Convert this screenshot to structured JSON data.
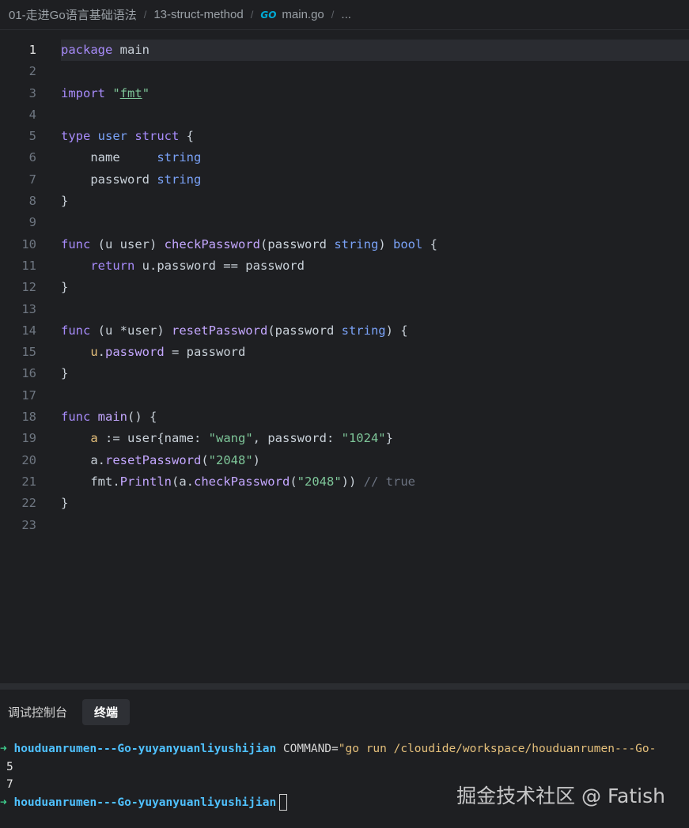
{
  "breadcrumb": {
    "items": [
      "01-走进Go语言基础语法",
      "13-struct-method",
      "main.go",
      "..."
    ],
    "file_icon": "go-file-icon"
  },
  "editor": {
    "active_line": 1,
    "lines": [
      {
        "n": "1"
      },
      {
        "n": "2"
      },
      {
        "n": "3"
      },
      {
        "n": "4"
      },
      {
        "n": "5"
      },
      {
        "n": "6"
      },
      {
        "n": "7"
      },
      {
        "n": "8"
      },
      {
        "n": "9"
      },
      {
        "n": "10"
      },
      {
        "n": "11"
      },
      {
        "n": "12"
      },
      {
        "n": "13"
      },
      {
        "n": "14"
      },
      {
        "n": "15"
      },
      {
        "n": "16"
      },
      {
        "n": "17"
      },
      {
        "n": "18"
      },
      {
        "n": "19"
      },
      {
        "n": "20"
      },
      {
        "n": "21"
      },
      {
        "n": "22"
      },
      {
        "n": "23"
      }
    ],
    "code": {
      "l1": [
        [
          "kw",
          "package"
        ],
        [
          "pl",
          " main"
        ]
      ],
      "l2": [],
      "l3": [
        [
          "kw",
          "import"
        ],
        [
          "pl",
          " "
        ],
        [
          "str",
          "\""
        ],
        [
          "strb",
          "fmt"
        ],
        [
          "str",
          "\""
        ]
      ],
      "l4": [],
      "l5": [
        [
          "kw",
          "type"
        ],
        [
          "pl",
          " "
        ],
        [
          "tp",
          "user"
        ],
        [
          "pl",
          " "
        ],
        [
          "kw",
          "struct"
        ],
        [
          "pl",
          " {"
        ]
      ],
      "l6": [
        [
          "pl",
          "    name     "
        ],
        [
          "tp",
          "string"
        ]
      ],
      "l7": [
        [
          "pl",
          "    password "
        ],
        [
          "tp",
          "string"
        ]
      ],
      "l8": [
        [
          "pl",
          "}"
        ]
      ],
      "l9": [],
      "l10": [
        [
          "kw",
          "func"
        ],
        [
          "pl",
          " (u user) "
        ],
        [
          "fnc",
          "checkPassword"
        ],
        [
          "pl",
          "(password "
        ],
        [
          "tp",
          "string"
        ],
        [
          "pl",
          ") "
        ],
        [
          "tp",
          "bool"
        ],
        [
          "pl",
          " {"
        ]
      ],
      "l11": [
        [
          "pl",
          "    "
        ],
        [
          "kw",
          "return"
        ],
        [
          "pl",
          " u.password == password"
        ]
      ],
      "l12": [
        [
          "pl",
          "}"
        ]
      ],
      "l13": [],
      "l14": [
        [
          "kw",
          "func"
        ],
        [
          "pl",
          " (u *user) "
        ],
        [
          "fnc",
          "resetPassword"
        ],
        [
          "pl",
          "(password "
        ],
        [
          "tp",
          "string"
        ],
        [
          "pl",
          ") {"
        ]
      ],
      "l15": [
        [
          "pl",
          "    "
        ],
        [
          "var",
          "u"
        ],
        [
          "pl",
          "."
        ],
        [
          "fnc",
          "password"
        ],
        [
          "pl",
          " = password"
        ]
      ],
      "l16": [
        [
          "pl",
          "}"
        ]
      ],
      "l17": [],
      "l18": [
        [
          "kw",
          "func"
        ],
        [
          "pl",
          " "
        ],
        [
          "fnc",
          "main"
        ],
        [
          "pl",
          "() {"
        ]
      ],
      "l19": [
        [
          "pl",
          "    "
        ],
        [
          "var",
          "a"
        ],
        [
          "pl",
          " := user{name: "
        ],
        [
          "str",
          "\"wang\""
        ],
        [
          "pl",
          ", password: "
        ],
        [
          "str",
          "\"1024\""
        ],
        [
          "pl",
          "}"
        ]
      ],
      "l20": [
        [
          "pl",
          "    a."
        ],
        [
          "fnc",
          "resetPassword"
        ],
        [
          "pl",
          "("
        ],
        [
          "str",
          "\"2048\""
        ],
        [
          "pl",
          ")"
        ]
      ],
      "l21": [
        [
          "pl",
          "    fmt."
        ],
        [
          "fnc",
          "Println"
        ],
        [
          "pl",
          "(a."
        ],
        [
          "fnc",
          "checkPassword"
        ],
        [
          "pl",
          "("
        ],
        [
          "str",
          "\"2048\""
        ],
        [
          "pl",
          "))"
        ],
        [
          "cmt",
          " // true"
        ]
      ],
      "l22": [
        [
          "pl",
          "}"
        ]
      ],
      "l23": []
    }
  },
  "panel": {
    "tabs": [
      {
        "label": "调试控制台",
        "active": false
      },
      {
        "label": "终端",
        "active": true
      }
    ]
  },
  "terminal": {
    "prompt_arrow": "➜",
    "host": "houduanrumen---Go-yuyanyuanliyushijian",
    "command_key": " COMMAND=",
    "command_value": "\"go run /cloudide/workspace/houduanrumen---Go-",
    "outputs": [
      "5",
      "7"
    ]
  },
  "watermark": "掘金技术社区 @ Fatish",
  "colors": {
    "background": "#1e1f22",
    "keyword": "#a78bfa",
    "type": "#7aa2f7",
    "string": "#7ec699",
    "prompt_arrow": "#3fcf8e",
    "host": "#4fc1ff"
  }
}
